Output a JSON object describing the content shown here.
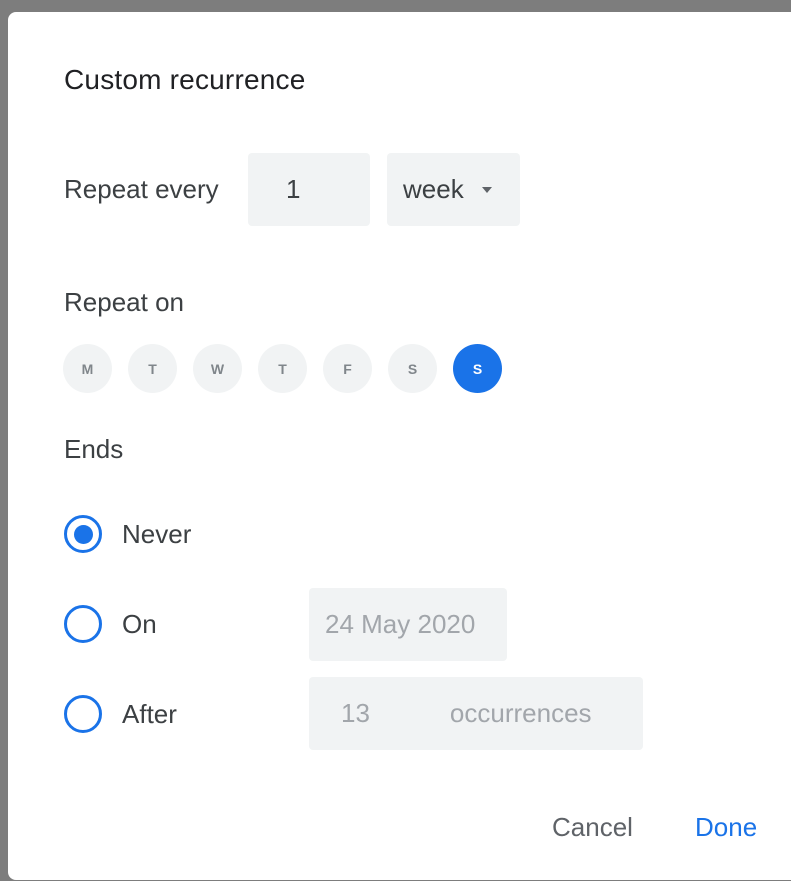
{
  "dialog": {
    "title": "Custom recurrence"
  },
  "repeat_every": {
    "label": "Repeat every",
    "interval_value": "1",
    "unit_value": "week"
  },
  "repeat_on": {
    "label": "Repeat on",
    "days": [
      {
        "letter": "M",
        "selected": false
      },
      {
        "letter": "T",
        "selected": false
      },
      {
        "letter": "W",
        "selected": false
      },
      {
        "letter": "T",
        "selected": false
      },
      {
        "letter": "F",
        "selected": false
      },
      {
        "letter": "S",
        "selected": false
      },
      {
        "letter": "S",
        "selected": true
      }
    ]
  },
  "ends": {
    "label": "Ends",
    "options": [
      {
        "label": "Never",
        "checked": true
      },
      {
        "label": "On",
        "checked": false
      },
      {
        "label": "After",
        "checked": false
      }
    ],
    "on_date": "24 May 2020",
    "after_count": "13",
    "after_unit": "occurrences"
  },
  "actions": {
    "cancel_label": "Cancel",
    "done_label": "Done"
  },
  "colors": {
    "accent": "#1a73e8",
    "field_bg": "#f1f3f4"
  }
}
